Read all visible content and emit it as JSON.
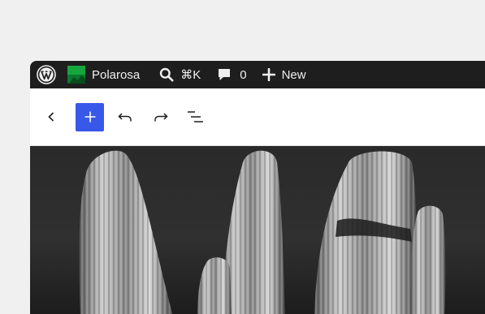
{
  "adminbar": {
    "logo_icon": "wordpress-logo-icon",
    "site_name": "Polarosa",
    "search_shortcut": "⌘K",
    "comments_count": "0",
    "new_label": "New"
  },
  "toolbar": {
    "icons": [
      "chevron-left-icon",
      "plus-icon",
      "undo-icon",
      "redo-icon",
      "list-view-icon"
    ],
    "accent_color": "#3858e9"
  },
  "canvas": {
    "image": "black-and-white saguaro cactus photo"
  }
}
